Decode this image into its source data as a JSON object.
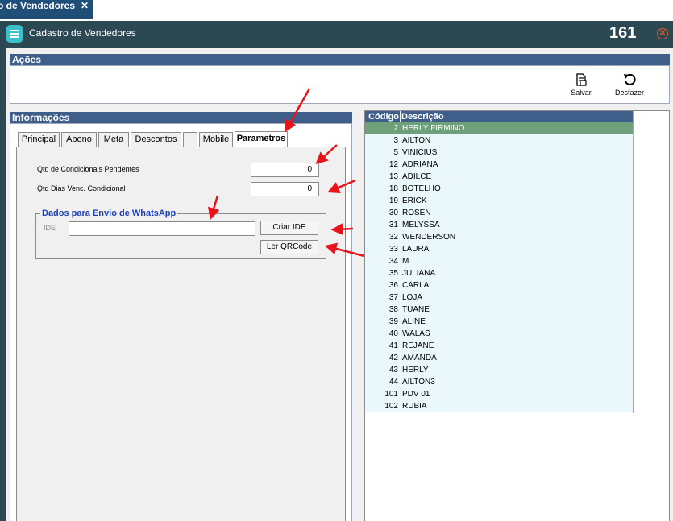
{
  "doc_tab": {
    "label": "o de Vendedores",
    "close_glyph": "✕"
  },
  "window": {
    "title": "Cadastro de Vendedores",
    "record_count": "161",
    "close_glyph": "✕"
  },
  "actions": {
    "section_title": "Ações",
    "save_label": "Salvar",
    "undo_label": "Desfazer"
  },
  "info": {
    "section_title": "Informações"
  },
  "tabs": [
    {
      "label": "Principal"
    },
    {
      "label": "Abono"
    },
    {
      "label": "Meta"
    },
    {
      "label": "Descontos"
    },
    {
      "label": ""
    },
    {
      "label": "Mobile"
    },
    {
      "label": "Parametros",
      "active": true
    }
  ],
  "params": {
    "pending_label": "Qtd de Condicionais Pendentes",
    "pending_value": "0",
    "days_label": "Qtd Dias Venc. Condicional",
    "days_value": "0",
    "whatsapp": {
      "group_title": "Dados para Envio de WhatsApp",
      "ide_label": "IDE",
      "ide_value": "",
      "create_button": "Criar IDE",
      "qrcode_button": "Ler QRCode"
    }
  },
  "grid": {
    "columns": [
      "Código",
      "Descrição"
    ],
    "rows": [
      {
        "code": "2",
        "desc": "HERLY  FIRMINO",
        "selected": true
      },
      {
        "code": "3",
        "desc": "AILTON"
      },
      {
        "code": "5",
        "desc": "VINICIUS"
      },
      {
        "code": "12",
        "desc": "ADRIANA"
      },
      {
        "code": "13",
        "desc": "ADILCE"
      },
      {
        "code": "18",
        "desc": "BOTELHO"
      },
      {
        "code": "19",
        "desc": "ERICK"
      },
      {
        "code": "30",
        "desc": "ROSEN"
      },
      {
        "code": "31",
        "desc": "MELYSSA"
      },
      {
        "code": "32",
        "desc": "WENDERSON"
      },
      {
        "code": "33",
        "desc": "LAURA"
      },
      {
        "code": "34",
        "desc": "M"
      },
      {
        "code": "35",
        "desc": "JULIANA"
      },
      {
        "code": "36",
        "desc": "CARLA"
      },
      {
        "code": "37",
        "desc": "LOJA"
      },
      {
        "code": "38",
        "desc": "TUANE"
      },
      {
        "code": "39",
        "desc": "ALINE"
      },
      {
        "code": "40",
        "desc": "WALAS"
      },
      {
        "code": "41",
        "desc": "REJANE"
      },
      {
        "code": "42",
        "desc": "AMANDA"
      },
      {
        "code": "43",
        "desc": "HERLY"
      },
      {
        "code": "44",
        "desc": "AILTON3"
      },
      {
        "code": "101",
        "desc": "PDV 01"
      },
      {
        "code": "102",
        "desc": "RUBIA"
      }
    ]
  },
  "colors": {
    "header": "#3f5f8a",
    "titlebar": "#2c4852",
    "selected_row": "#6ea17a",
    "annotation": "#e8141b"
  }
}
